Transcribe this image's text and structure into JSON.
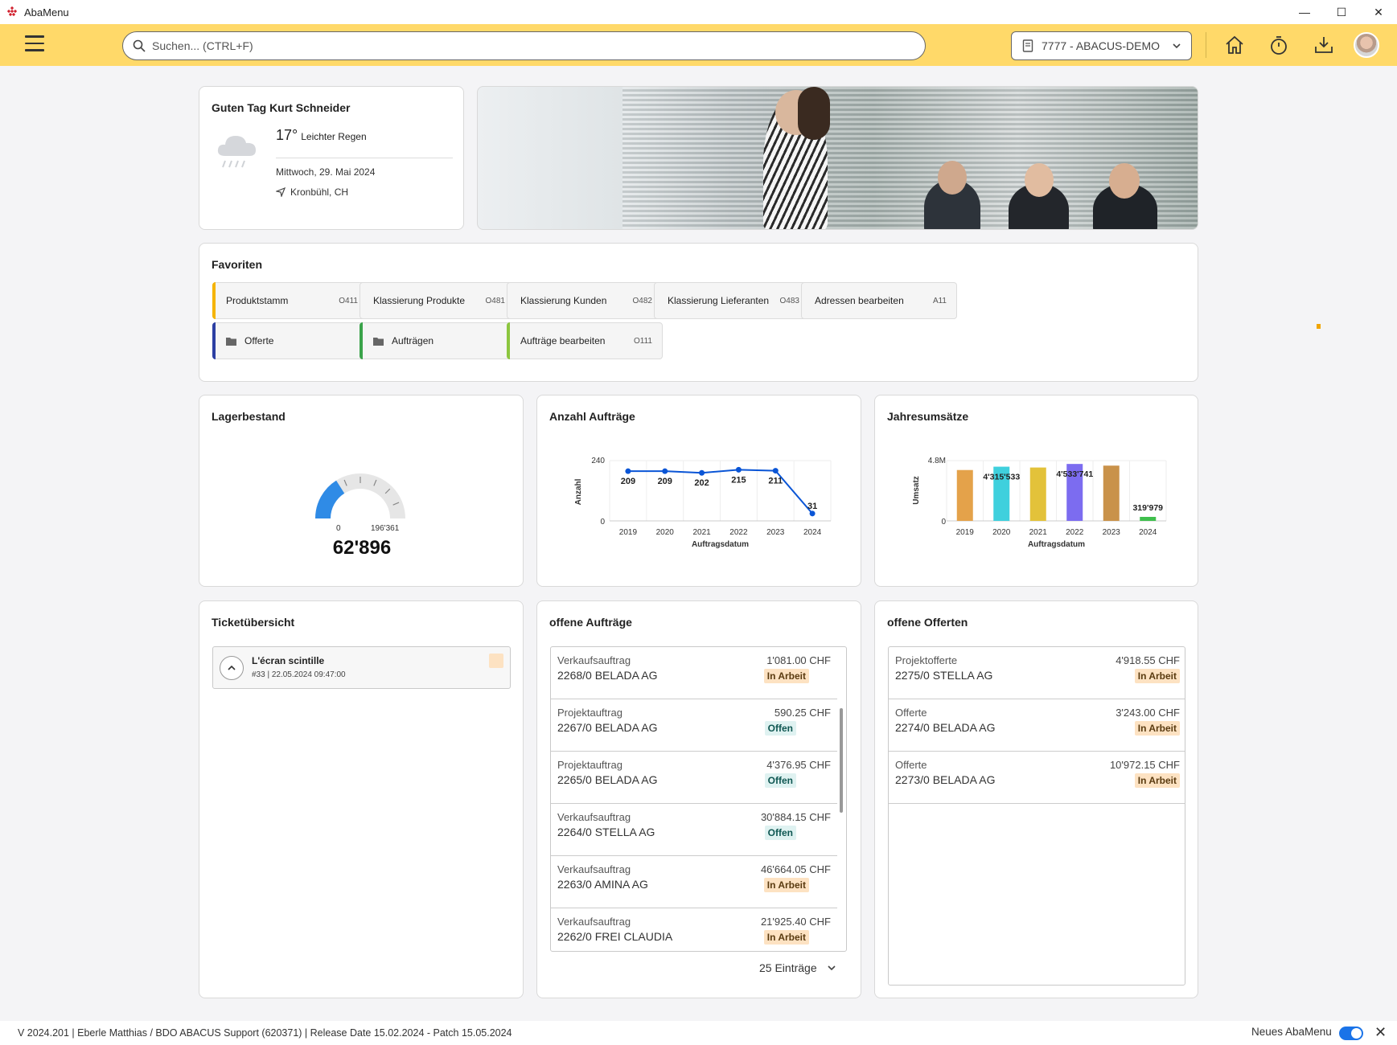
{
  "app": {
    "title": "AbaMenu"
  },
  "window": {
    "minimize": "—",
    "maximize": "☐",
    "close": "✕"
  },
  "topbar": {
    "search_placeholder": "Suchen... (CTRL+F)",
    "mandant": "7777 - ABACUS-DEMO",
    "icons": [
      "home-icon",
      "timer-icon",
      "download-icon",
      "avatar"
    ]
  },
  "greeting": {
    "title": "Guten Tag Kurt Schneider",
    "temperature": "17°",
    "weather": "Leichter Regen",
    "date": "Mittwoch, 29. Mai 2024",
    "location": "Kronbühl, CH"
  },
  "favorites": {
    "title": "Favoriten",
    "items": [
      {
        "label": "Produktstamm",
        "code": "O411",
        "color": "#f5b400",
        "folder": false
      },
      {
        "label": "Klassierung Produkte",
        "code": "O481",
        "color": "",
        "folder": false
      },
      {
        "label": "Klassierung Kunden",
        "code": "O482",
        "color": "",
        "folder": false
      },
      {
        "label": "Klassierung Lieferanten",
        "code": "O483",
        "color": "",
        "folder": false
      },
      {
        "label": "Adressen bearbeiten",
        "code": "A11",
        "color": "",
        "folder": false
      },
      {
        "label": "Offerte",
        "code": "",
        "color": "#2c3fa3",
        "folder": true
      },
      {
        "label": "Aufträgen",
        "code": "",
        "color": "#3aa34a",
        "folder": true
      },
      {
        "label": "Aufträge bearbeiten",
        "code": "O111",
        "color": "#8cc63f",
        "folder": false
      }
    ]
  },
  "lagerbestand": {
    "title": "Lagerbestand",
    "min": "0",
    "max": "196'361",
    "value_text": "62'896",
    "value": 62896,
    "max_value": 196361
  },
  "auftraege_chart": {
    "title": "Anzahl Aufträge",
    "chart_data": {
      "type": "line",
      "x": [
        "2019",
        "2020",
        "2021",
        "2022",
        "2023",
        "2024"
      ],
      "values": [
        209,
        209,
        202,
        215,
        211,
        31
      ],
      "xlabel": "Auftragsdatum",
      "ylabel": "Anzahl",
      "ylim": [
        0,
        240
      ],
      "yticks": [
        "0",
        "240"
      ],
      "color": "#0a55d6"
    }
  },
  "umsatz_chart": {
    "title": "Jahresumsätze",
    "chart_data": {
      "type": "bar",
      "categories": [
        "2019",
        "2020",
        "2021",
        "2022",
        "2023",
        "2024"
      ],
      "values": [
        4050000,
        4315533,
        4250000,
        4533741,
        4400000,
        319979
      ],
      "data_labels": [
        "",
        "4'315'533",
        "",
        "4'533'741",
        "",
        "319'979"
      ],
      "colors": [
        "#e4a24a",
        "#3fd0dd",
        "#e3c23a",
        "#7c6cf0",
        "#c9924a",
        "#3fbf4d"
      ],
      "xlabel": "Auftragsdatum",
      "ylabel": "Umsatz",
      "ylim": [
        0,
        4800000
      ],
      "yticks": [
        "0",
        "4.8M"
      ]
    }
  },
  "tickets": {
    "title": "Ticketübersicht",
    "items": [
      {
        "title": "L'écran scintille",
        "sub": "#33 | 22.05.2024 09:47:00"
      }
    ]
  },
  "offene_auftraege": {
    "title": "offene Aufträge",
    "rows": [
      {
        "type": "Verkaufsauftrag",
        "id": "2268/0  BELADA AG",
        "amount": "1'081.00 CHF",
        "status": "In Arbeit"
      },
      {
        "type": "Projektauftrag",
        "id": "2267/0  BELADA AG",
        "amount": "590.25 CHF",
        "status": "Offen"
      },
      {
        "type": "Projektauftrag",
        "id": "2265/0  BELADA AG",
        "amount": "4'376.95 CHF",
        "status": "Offen"
      },
      {
        "type": "Verkaufsauftrag",
        "id": "2264/0  STELLA AG",
        "amount": "30'884.15 CHF",
        "status": "Offen"
      },
      {
        "type": "Verkaufsauftrag",
        "id": "2263/0  AMINA AG",
        "amount": "46'664.05 CHF",
        "status": "In Arbeit"
      },
      {
        "type": "Verkaufsauftrag",
        "id": "2262/0  FREI CLAUDIA",
        "amount": "21'925.40 CHF",
        "status": "In Arbeit"
      }
    ],
    "entries": "25 Einträge"
  },
  "offene_offerten": {
    "title": "offene Offerten",
    "rows": [
      {
        "type": "Projektofferte",
        "id": "2275/0  STELLA AG",
        "amount": "4'918.55 CHF",
        "status": "In Arbeit"
      },
      {
        "type": "Offerte",
        "id": "2274/0  BELADA AG",
        "amount": "3'243.00 CHF",
        "status": "In Arbeit"
      },
      {
        "type": "Offerte",
        "id": "2273/0  BELADA AG",
        "amount": "10'972.15 CHF",
        "status": "In Arbeit"
      }
    ]
  },
  "footer": {
    "version": "V 2024.201 | Eberle Matthias / BDO ABACUS Support (620371) | Release Date 15.02.2024 - Patch 15.05.2024",
    "new_menu": "Neues AbaMenu",
    "close": "✕"
  }
}
